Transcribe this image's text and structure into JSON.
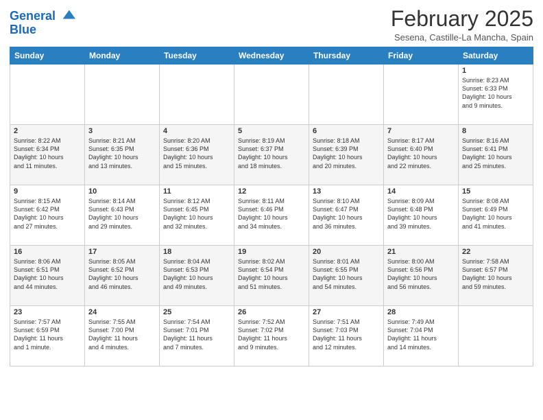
{
  "logo": {
    "line1": "General",
    "line2": "Blue"
  },
  "title": "February 2025",
  "location": "Sesena, Castille-La Mancha, Spain",
  "weekdays": [
    "Sunday",
    "Monday",
    "Tuesday",
    "Wednesday",
    "Thursday",
    "Friday",
    "Saturday"
  ],
  "weeks": [
    [
      {
        "day": "",
        "info": ""
      },
      {
        "day": "",
        "info": ""
      },
      {
        "day": "",
        "info": ""
      },
      {
        "day": "",
        "info": ""
      },
      {
        "day": "",
        "info": ""
      },
      {
        "day": "",
        "info": ""
      },
      {
        "day": "1",
        "info": "Sunrise: 8:23 AM\nSunset: 6:33 PM\nDaylight: 10 hours\nand 9 minutes."
      }
    ],
    [
      {
        "day": "2",
        "info": "Sunrise: 8:22 AM\nSunset: 6:34 PM\nDaylight: 10 hours\nand 11 minutes."
      },
      {
        "day": "3",
        "info": "Sunrise: 8:21 AM\nSunset: 6:35 PM\nDaylight: 10 hours\nand 13 minutes."
      },
      {
        "day": "4",
        "info": "Sunrise: 8:20 AM\nSunset: 6:36 PM\nDaylight: 10 hours\nand 15 minutes."
      },
      {
        "day": "5",
        "info": "Sunrise: 8:19 AM\nSunset: 6:37 PM\nDaylight: 10 hours\nand 18 minutes."
      },
      {
        "day": "6",
        "info": "Sunrise: 8:18 AM\nSunset: 6:39 PM\nDaylight: 10 hours\nand 20 minutes."
      },
      {
        "day": "7",
        "info": "Sunrise: 8:17 AM\nSunset: 6:40 PM\nDaylight: 10 hours\nand 22 minutes."
      },
      {
        "day": "8",
        "info": "Sunrise: 8:16 AM\nSunset: 6:41 PM\nDaylight: 10 hours\nand 25 minutes."
      }
    ],
    [
      {
        "day": "9",
        "info": "Sunrise: 8:15 AM\nSunset: 6:42 PM\nDaylight: 10 hours\nand 27 minutes."
      },
      {
        "day": "10",
        "info": "Sunrise: 8:14 AM\nSunset: 6:43 PM\nDaylight: 10 hours\nand 29 minutes."
      },
      {
        "day": "11",
        "info": "Sunrise: 8:12 AM\nSunset: 6:45 PM\nDaylight: 10 hours\nand 32 minutes."
      },
      {
        "day": "12",
        "info": "Sunrise: 8:11 AM\nSunset: 6:46 PM\nDaylight: 10 hours\nand 34 minutes."
      },
      {
        "day": "13",
        "info": "Sunrise: 8:10 AM\nSunset: 6:47 PM\nDaylight: 10 hours\nand 36 minutes."
      },
      {
        "day": "14",
        "info": "Sunrise: 8:09 AM\nSunset: 6:48 PM\nDaylight: 10 hours\nand 39 minutes."
      },
      {
        "day": "15",
        "info": "Sunrise: 8:08 AM\nSunset: 6:49 PM\nDaylight: 10 hours\nand 41 minutes."
      }
    ],
    [
      {
        "day": "16",
        "info": "Sunrise: 8:06 AM\nSunset: 6:51 PM\nDaylight: 10 hours\nand 44 minutes."
      },
      {
        "day": "17",
        "info": "Sunrise: 8:05 AM\nSunset: 6:52 PM\nDaylight: 10 hours\nand 46 minutes."
      },
      {
        "day": "18",
        "info": "Sunrise: 8:04 AM\nSunset: 6:53 PM\nDaylight: 10 hours\nand 49 minutes."
      },
      {
        "day": "19",
        "info": "Sunrise: 8:02 AM\nSunset: 6:54 PM\nDaylight: 10 hours\nand 51 minutes."
      },
      {
        "day": "20",
        "info": "Sunrise: 8:01 AM\nSunset: 6:55 PM\nDaylight: 10 hours\nand 54 minutes."
      },
      {
        "day": "21",
        "info": "Sunrise: 8:00 AM\nSunset: 6:56 PM\nDaylight: 10 hours\nand 56 minutes."
      },
      {
        "day": "22",
        "info": "Sunrise: 7:58 AM\nSunset: 6:57 PM\nDaylight: 10 hours\nand 59 minutes."
      }
    ],
    [
      {
        "day": "23",
        "info": "Sunrise: 7:57 AM\nSunset: 6:59 PM\nDaylight: 11 hours\nand 1 minute."
      },
      {
        "day": "24",
        "info": "Sunrise: 7:55 AM\nSunset: 7:00 PM\nDaylight: 11 hours\nand 4 minutes."
      },
      {
        "day": "25",
        "info": "Sunrise: 7:54 AM\nSunset: 7:01 PM\nDaylight: 11 hours\nand 7 minutes."
      },
      {
        "day": "26",
        "info": "Sunrise: 7:52 AM\nSunset: 7:02 PM\nDaylight: 11 hours\nand 9 minutes."
      },
      {
        "day": "27",
        "info": "Sunrise: 7:51 AM\nSunset: 7:03 PM\nDaylight: 11 hours\nand 12 minutes."
      },
      {
        "day": "28",
        "info": "Sunrise: 7:49 AM\nSunset: 7:04 PM\nDaylight: 11 hours\nand 14 minutes."
      },
      {
        "day": "",
        "info": ""
      }
    ]
  ]
}
